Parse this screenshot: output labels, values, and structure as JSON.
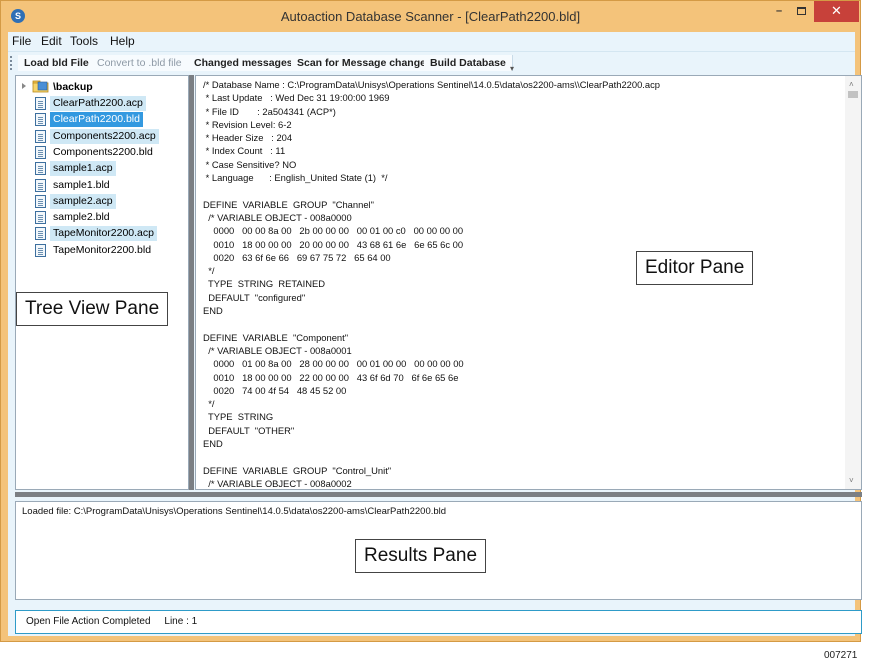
{
  "window": {
    "title": "Autoaction Database Scanner - [ClearPath2200.bld]",
    "icon": "app-icon",
    "minimize_glyph": "–",
    "close_glyph": "✕"
  },
  "menu": {
    "items": [
      "File",
      "Edit",
      "Tools",
      "Help"
    ]
  },
  "toolbar": {
    "buttons": [
      {
        "label": "Load bld File",
        "enabled": true
      },
      {
        "label": "Convert to .bld file",
        "enabled": false
      },
      {
        "label": "Changed messages",
        "enabled": true
      },
      {
        "label": "Scan for Message changes",
        "enabled": true
      },
      {
        "label": "Build Database",
        "enabled": true
      }
    ],
    "overflow_glyph": "▾"
  },
  "tree": {
    "root_label": "\\backup",
    "items": [
      {
        "label": "ClearPath2200.acp",
        "state": "highlighted"
      },
      {
        "label": "ClearPath2200.bld",
        "state": "selected"
      },
      {
        "label": "Components2200.acp",
        "state": "highlighted"
      },
      {
        "label": "Components2200.bld",
        "state": "normal"
      },
      {
        "label": "sample1.acp",
        "state": "highlighted"
      },
      {
        "label": "sample1.bld",
        "state": "normal"
      },
      {
        "label": "sample2.acp",
        "state": "highlighted"
      },
      {
        "label": "sample2.bld",
        "state": "normal"
      },
      {
        "label": "TapeMonitor2200.acp",
        "state": "highlighted"
      },
      {
        "label": "TapeMonitor2200.bld",
        "state": "normal"
      }
    ]
  },
  "labels": {
    "tree_pane": "Tree View Pane",
    "editor_pane": "Editor Pane",
    "results_pane": "Results Pane"
  },
  "editor": {
    "lines": [
      "/* Database Name : C:\\ProgramData\\Unisys\\Operations Sentinel\\14.0.5\\data\\os2200-ams\\\\ClearPath2200.acp",
      " * Last Update   : Wed Dec 31 19:00:00 1969",
      " * File ID       : 2a504341 (ACP*)",
      " * Revision Level: 6-2",
      " * Header Size   : 204",
      " * Index Count   : 11",
      " * Case Sensitive? NO",
      " * Language      : English_United State (1)  */",
      "",
      "DEFINE  VARIABLE  GROUP  \"Channel\"",
      "  /* VARIABLE OBJECT - 008a0000",
      "    0000   00 00 8a 00   2b 00 00 00   00 01 00 c0   00 00 00 00",
      "    0010   18 00 00 00   20 00 00 00   43 68 61 6e   6e 65 6c 00",
      "    0020   63 6f 6e 66   69 67 75 72   65 64 00",
      "  */",
      "  TYPE  STRING  RETAINED",
      "  DEFAULT  \"configured\"",
      "END",
      "",
      "DEFINE  VARIABLE  \"Component\"",
      "  /* VARIABLE OBJECT - 008a0001",
      "    0000   01 00 8a 00   28 00 00 00   00 01 00 00   00 00 00 00",
      "    0010   18 00 00 00   22 00 00 00   43 6f 6d 70   6f 6e 65 6e",
      "    0020   74 00 4f 54   48 45 52 00",
      "  */",
      "  TYPE  STRING",
      "  DEFAULT  \"OTHER\"",
      "END",
      "",
      "DEFINE  VARIABLE  GROUP  \"Control_Unit\"",
      "  /* VARIABLE OBJECT - 008a0002"
    ]
  },
  "results": {
    "text": "Loaded file: C:\\ProgramData\\Unisys\\Operations Sentinel\\14.0.5\\data\\os2200-ams\\ClearPath2200.bld"
  },
  "status": {
    "text": "Open File Action Completed     Line : 1"
  },
  "figure_id": "007271",
  "colors": {
    "window_frame": "#f4c37a",
    "close_button": "#c7413a",
    "selection": "#3399e0",
    "highlight": "#cfe8f5",
    "client_bg": "#e9f4fb",
    "status_border": "#2e9bc8"
  }
}
